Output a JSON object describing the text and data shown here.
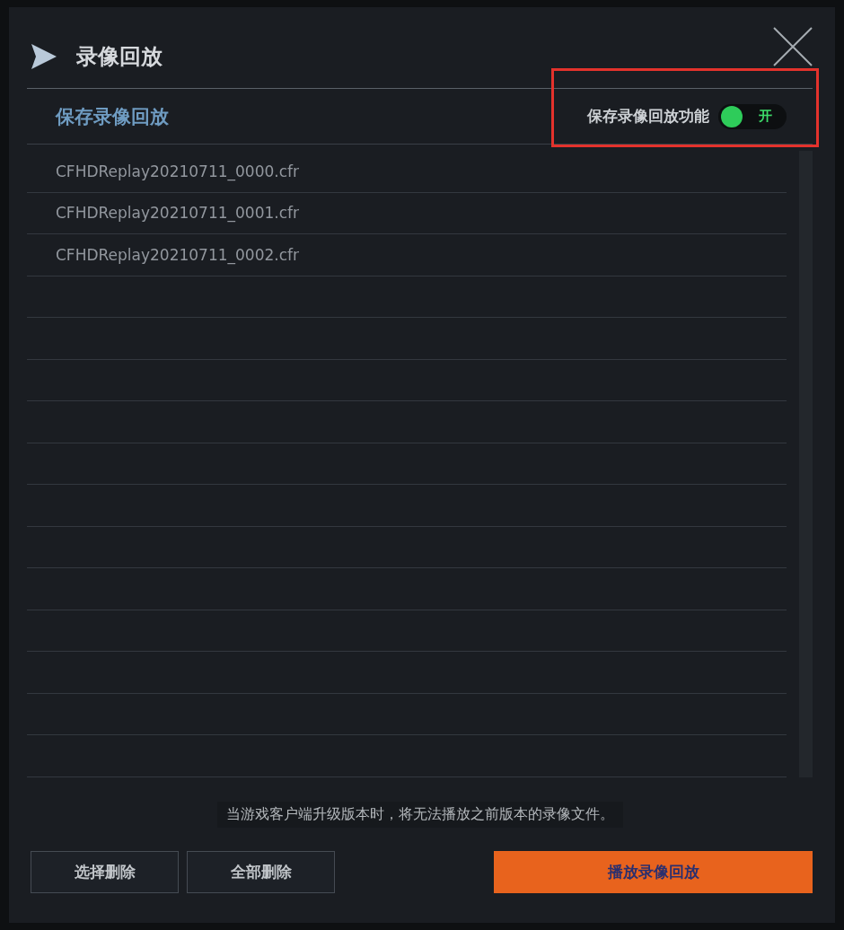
{
  "dialog": {
    "title": "录像回放"
  },
  "section": {
    "title": "保存录像回放",
    "toggle": {
      "label": "保存录像回放功能",
      "on": true,
      "state_text": "开",
      "highlighted": true
    }
  },
  "files": [
    {
      "name": "CFHDReplay20210711_0000.cfr"
    },
    {
      "name": "CFHDReplay20210711_0001.cfr"
    },
    {
      "name": "CFHDReplay20210711_0002.cfr"
    }
  ],
  "notice": "当游戏客户端升级版本时，将无法播放之前版本的录像文件。",
  "buttons": [
    {
      "label": "选择删除",
      "kind": "secondary"
    },
    {
      "label": "全部删除",
      "kind": "secondary"
    },
    {
      "label": "播放录像回放",
      "kind": "primary"
    }
  ]
}
